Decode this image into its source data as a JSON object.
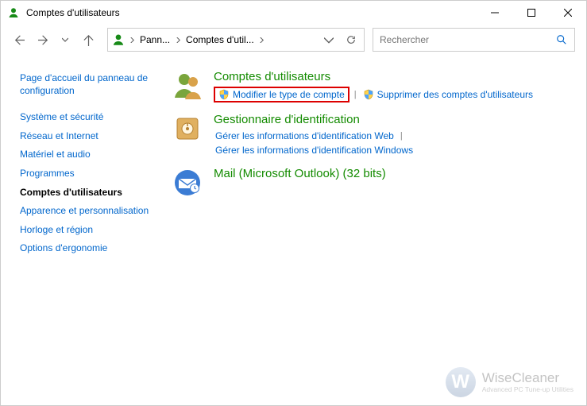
{
  "window": {
    "title": "Comptes d'utilisateurs"
  },
  "nav": {
    "breadcrumb": [
      {
        "text": "Pann..."
      },
      {
        "text": "Comptes d'util..."
      }
    ],
    "search_placeholder": "Rechercher"
  },
  "sidebar": {
    "home": "Page d'accueil du panneau de configuration",
    "items": [
      "Système et sécurité",
      "Réseau et Internet",
      "Matériel et audio",
      "Programmes",
      "Comptes d'utilisateurs",
      "Apparence et personnalisation",
      "Horloge et région",
      "Options d'ergonomie"
    ],
    "current_index": 4
  },
  "main": {
    "categories": [
      {
        "title": "Comptes d'utilisateurs",
        "tasks": [
          {
            "label": "Modifier le type de compte",
            "shield": true,
            "highlighted": true
          },
          {
            "sep": true
          },
          {
            "label": "Supprimer des comptes d'utilisateurs",
            "shield": true
          }
        ]
      },
      {
        "title": "Gestionnaire d'identification",
        "tasks": [
          {
            "label": "Gérer les informations d'identification Web"
          },
          {
            "sep": true
          },
          {
            "label": "Gérer les informations d'identification Windows"
          }
        ]
      },
      {
        "title": "Mail (Microsoft Outlook) (32 bits)",
        "tasks": []
      }
    ]
  },
  "watermark": {
    "letter": "W",
    "title": "WiseCleaner",
    "subtitle": "Advanced PC Tune-up Utilities"
  }
}
